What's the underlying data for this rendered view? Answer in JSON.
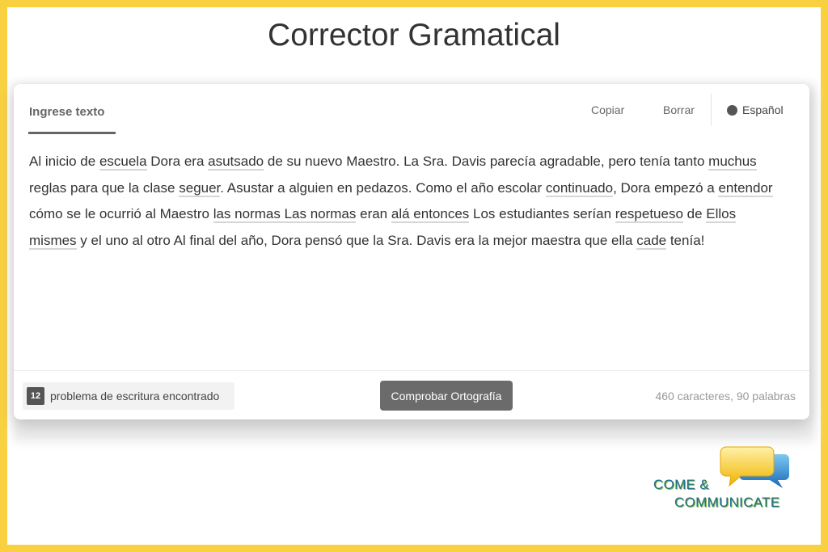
{
  "page": {
    "title": "Corrector Gramatical"
  },
  "editor": {
    "tab_label": "Ingrese texto",
    "toolbar": {
      "copy": "Copiar",
      "clear": "Borrar",
      "language": "Español"
    },
    "text_segments": [
      {
        "t": "Al inicio de "
      },
      {
        "t": "escuela",
        "e": true
      },
      {
        "t": " Dora era "
      },
      {
        "t": "asutsado",
        "e": true
      },
      {
        "t": " de su nuevo Maestro. La Sra. Davis parecía agradable, pero tenía tanto "
      },
      {
        "t": "muchus",
        "e": true
      },
      {
        "t": " reglas para que la clase "
      },
      {
        "t": "seguer",
        "e": true
      },
      {
        "t": ". Asustar a alguien en pedazos. Como el año escolar "
      },
      {
        "t": "continuado",
        "e": true
      },
      {
        "t": ", Dora empezó a "
      },
      {
        "t": "entendor",
        "e": true
      },
      {
        "t": " cómo se le ocurrió al Maestro "
      },
      {
        "t": "las normas Las normas",
        "e": true
      },
      {
        "t": " eran "
      },
      {
        "t": "alá entonces",
        "e": true
      },
      {
        "t": " Los estudiantes serían "
      },
      {
        "t": "respetueso",
        "e": true
      },
      {
        "t": " de "
      },
      {
        "t": "Ellos mismes",
        "e": true
      },
      {
        "t": " y el uno al otro Al final del año, Dora pensó que la Sra. Davis era la mejor maestra que ella "
      },
      {
        "t": "cade",
        "e": true
      },
      {
        "t": " tenía!"
      }
    ]
  },
  "footer": {
    "issue_count": "12",
    "issue_label": "problema de escritura encontrado",
    "check_button": "Comprobar Ortografía",
    "stats": "460 caracteres, 90 palabras"
  },
  "logo": {
    "line1": "COME &",
    "line2": "COMMUNICATE"
  },
  "colors": {
    "frame": "#f9d140",
    "button": "#6b6b6b",
    "logo_text": "#1f6f8a",
    "logo_accent": "#7fb539"
  }
}
